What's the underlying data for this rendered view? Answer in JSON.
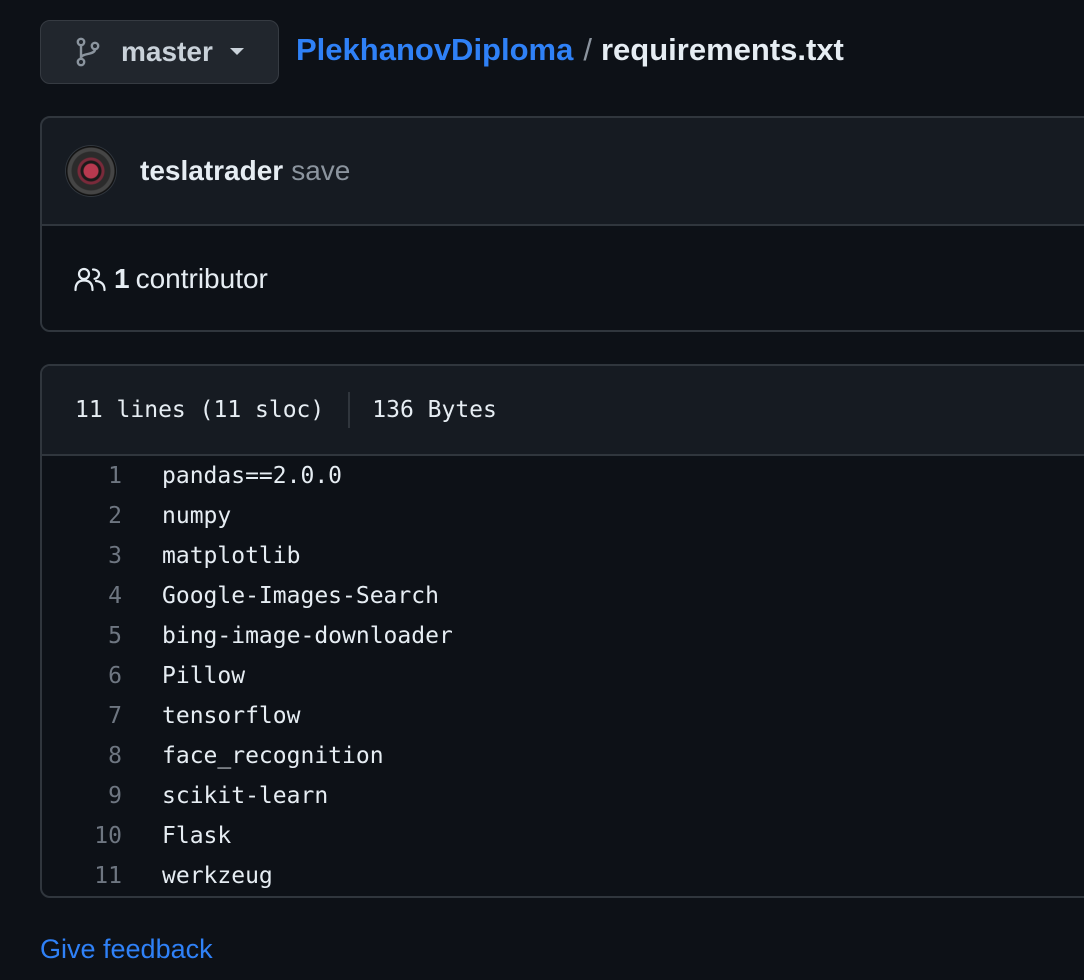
{
  "branch": {
    "label": "master",
    "icon": "git-branch-icon"
  },
  "breadcrumb": {
    "repo": "PlekhanovDiploma",
    "separator": "/",
    "file": "requirements.txt"
  },
  "commit": {
    "author": "teslatrader",
    "message": "save"
  },
  "contributors": {
    "count": "1",
    "label": "contributor"
  },
  "file": {
    "lines_info": "11 lines (11 sloc)",
    "size": "136 Bytes",
    "lines": [
      {
        "num": "1",
        "text": "pandas==2.0.0"
      },
      {
        "num": "2",
        "text": "numpy"
      },
      {
        "num": "3",
        "text": "matplotlib"
      },
      {
        "num": "4",
        "text": "Google-Images-Search"
      },
      {
        "num": "5",
        "text": "bing-image-downloader"
      },
      {
        "num": "6",
        "text": "Pillow"
      },
      {
        "num": "7",
        "text": "tensorflow"
      },
      {
        "num": "8",
        "text": "face_recognition"
      },
      {
        "num": "9",
        "text": "scikit-learn"
      },
      {
        "num": "10",
        "text": "Flask"
      },
      {
        "num": "11",
        "text": "werkzeug"
      }
    ]
  },
  "footer": {
    "feedback": "Give feedback"
  },
  "colors": {
    "background": "#0d1117",
    "link": "#2f81f7",
    "border": "#30363d",
    "muted": "#8b949e"
  }
}
